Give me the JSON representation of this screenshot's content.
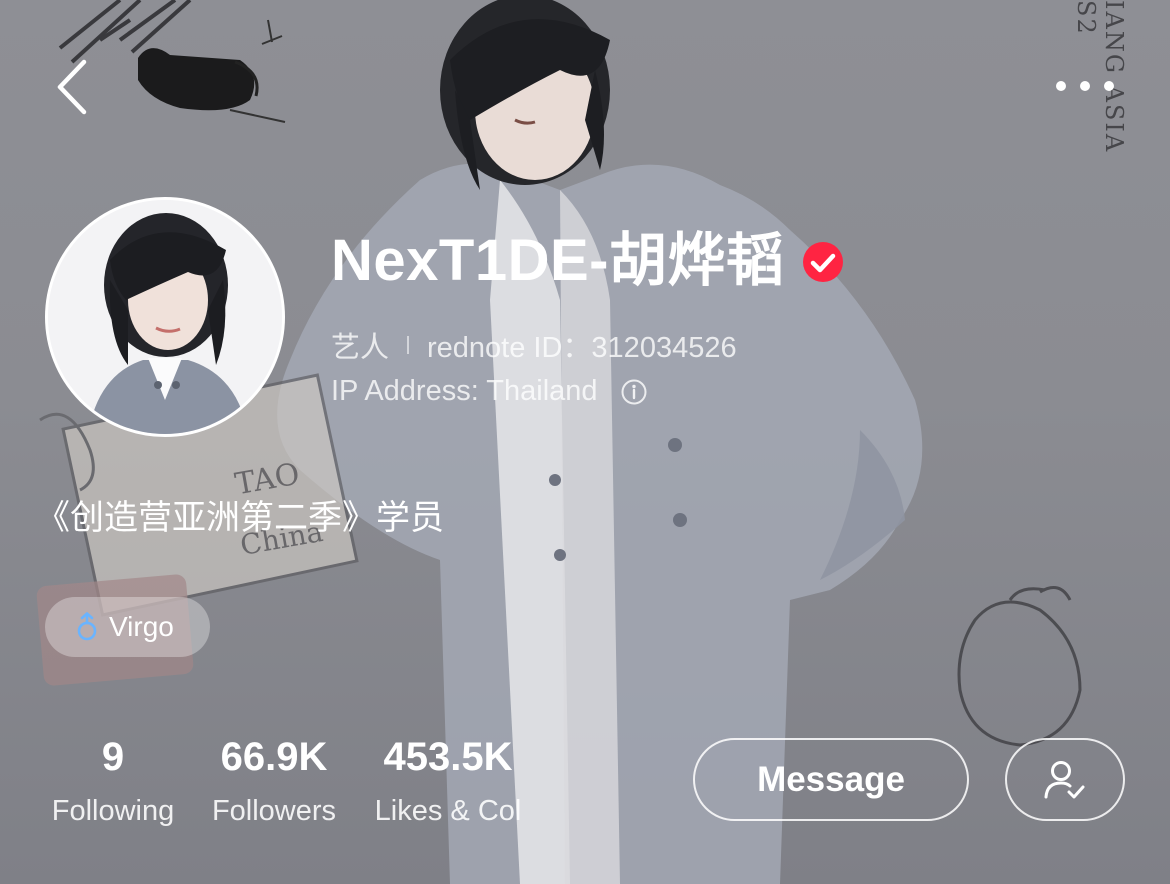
{
  "header": {
    "back_icon": "chevron-left-icon",
    "more_icon": "more-horizontal-icon"
  },
  "background": {
    "decor_text_vertical": "IANG ASIA S2",
    "card_text_1": "TAO",
    "card_text_2": "China"
  },
  "profile": {
    "name": "NexT1DE-胡烨韬",
    "verified_icon": "verified-badge-icon",
    "verified_color": "#ff2442",
    "category": "艺人",
    "id_label": "rednote ID：312034526",
    "ip_label": "IP Address: Thailand",
    "info_icon": "info-icon",
    "bio": "《创造营亚洲第二季》学员",
    "tag": {
      "icon": "male-gender-icon",
      "label": "Virgo",
      "icon_color": "#6ab4ff"
    }
  },
  "stats": [
    {
      "value": "9",
      "label": "Following"
    },
    {
      "value": "66.9K",
      "label": "Followers"
    },
    {
      "value": "453.5K",
      "label": "Likes & Col"
    }
  ],
  "actions": {
    "message_label": "Message",
    "follow_icon": "user-check-icon"
  }
}
